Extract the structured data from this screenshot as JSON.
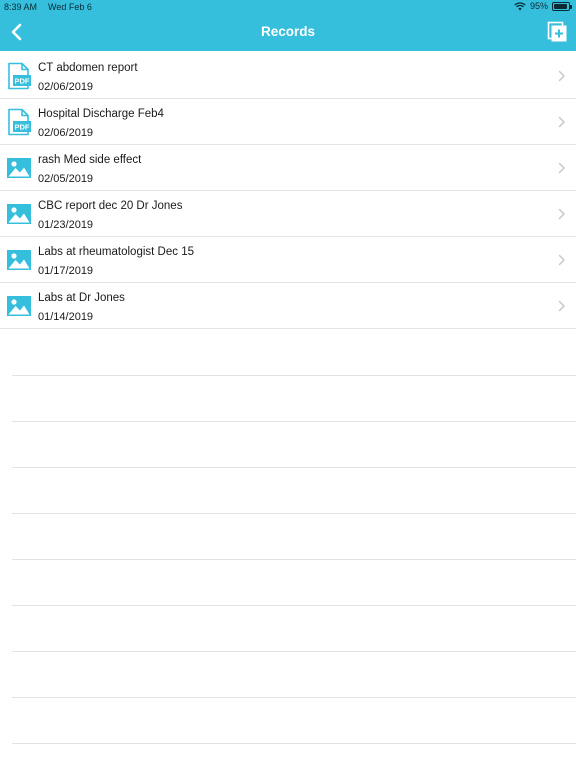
{
  "status_bar": {
    "time": "8:39 AM",
    "date": "Wed Feb 6",
    "battery": "95%",
    "battery_level": 0.95,
    "icons": [
      "wifi-icon",
      "battery-icon"
    ]
  },
  "nav": {
    "title": "Records",
    "back_icon": "chevron-left-icon",
    "add_icon": "add-document-icon",
    "bar_color": "#36bfdd",
    "icon_color": "#ffffff"
  },
  "records": [
    {
      "name": "CT abdomen report",
      "date": "02/06/2019",
      "type": "pdf",
      "icon": "pdf-icon"
    },
    {
      "name": "Hospital Discharge Feb4",
      "date": "02/06/2019",
      "type": "pdf",
      "icon": "pdf-icon"
    },
    {
      "name": "rash Med side effect",
      "date": "02/05/2019",
      "type": "image",
      "icon": "image-icon"
    },
    {
      "name": "CBC report dec 20 Dr Jones",
      "date": "01/23/2019",
      "type": "image",
      "icon": "image-icon"
    },
    {
      "name": "Labs at rheumatologist Dec 15",
      "date": "01/17/2019",
      "type": "image",
      "icon": "image-icon"
    },
    {
      "name": "Labs at Dr Jones",
      "date": "01/14/2019",
      "type": "image",
      "icon": "image-icon"
    }
  ],
  "pdf_label": "PDF",
  "accent_color": "#36bfdd",
  "chevron_color": "#c7c7cc"
}
